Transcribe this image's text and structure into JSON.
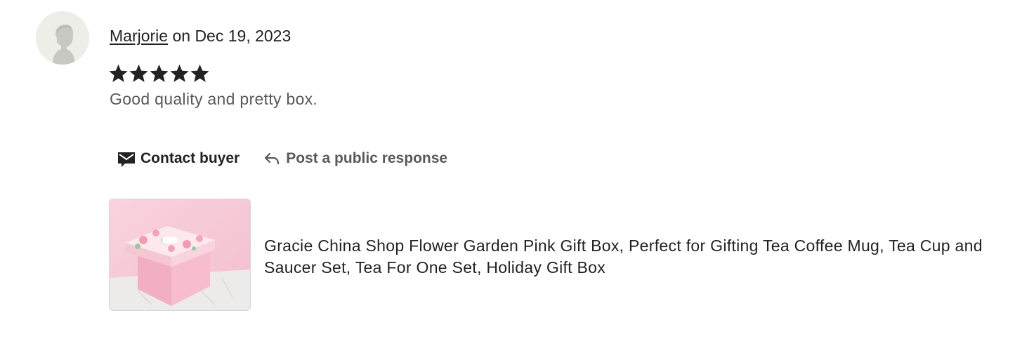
{
  "review": {
    "reviewer_name": "Marjorie",
    "date_text": " on Dec 19, 2023",
    "rating": 5,
    "rating_max": 5,
    "text": "Good quality and pretty box."
  },
  "actions": {
    "contact_label": "Contact buyer",
    "respond_label": "Post a public response"
  },
  "listing": {
    "title": "Gracie China Shop Flower Garden Pink Gift Box, Perfect for Gifting Tea Coffee Mug, Tea Cup and Saucer Set, Tea For One Set, Holiday Gift Box"
  },
  "icons": {
    "avatar": "default-avatar-icon",
    "star": "star-filled-icon",
    "contact": "envelope-message-icon",
    "respond": "reply-arrow-icon"
  },
  "colors": {
    "text_primary": "#222222",
    "text_secondary": "#595959",
    "star": "#222222",
    "avatar_bg": "#eeeee9",
    "avatar_silhouette": "#c7c7c3",
    "thumb_pink": "#f6c9d6"
  }
}
